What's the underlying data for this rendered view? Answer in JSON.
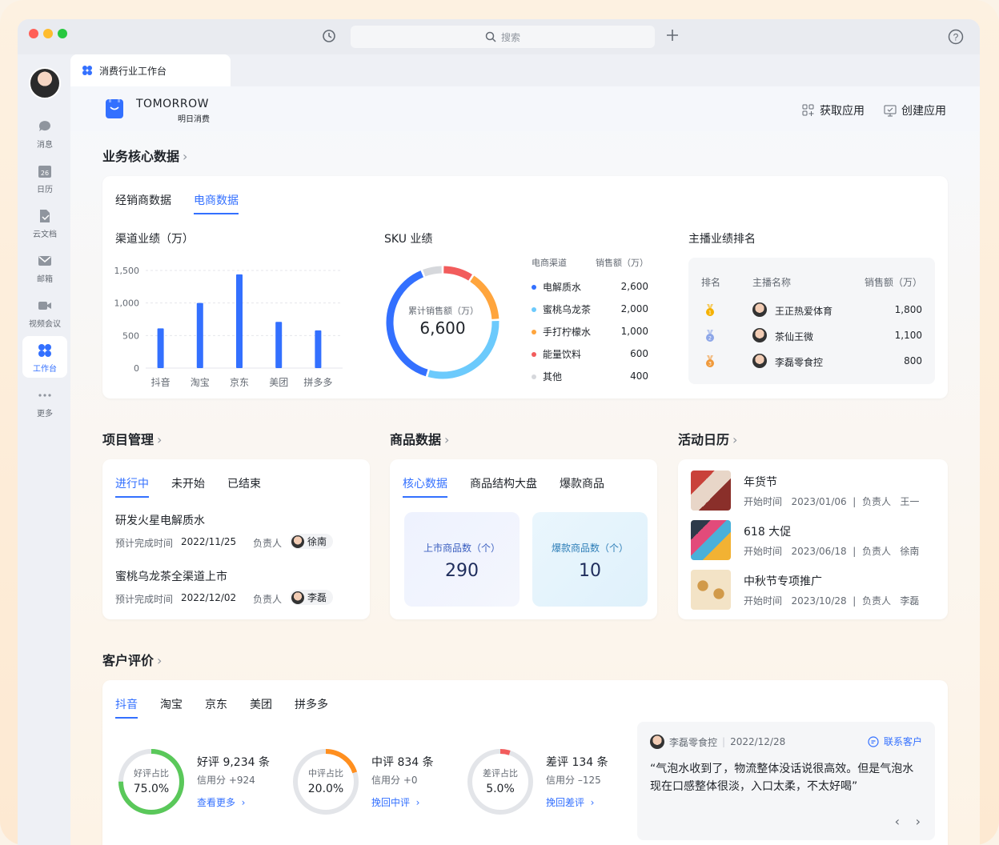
{
  "titlebar": {
    "search_placeholder": "搜索"
  },
  "sidebar": {
    "items": [
      {
        "label": "消息"
      },
      {
        "label": "日历"
      },
      {
        "label": "云文档"
      },
      {
        "label": "邮箱"
      },
      {
        "label": "视频会议"
      },
      {
        "label": "工作台"
      },
      {
        "label": "更多"
      }
    ],
    "calendar_day": "26"
  },
  "tab": {
    "title": "消费行业工作台"
  },
  "header": {
    "brand": "TOMORROW",
    "brand_sub": "明日消费",
    "get_apps": "获取应用",
    "create_app": "创建应用"
  },
  "core": {
    "title": "业务核心数据",
    "tabs": [
      "经销商数据",
      "电商数据"
    ],
    "channel_title": "渠道业绩（万）",
    "sku_title": "SKU 业绩",
    "sku_center_label": "累计销售额（万）",
    "sku_total": "6,600",
    "sku_headers": [
      "电商渠道",
      "销售额（万）"
    ],
    "sku_rows": [
      {
        "name": "电解质水",
        "value": "2,600",
        "color": "#3370ff"
      },
      {
        "name": "蜜桃乌龙茶",
        "value": "2,000",
        "color": "#6ccafc"
      },
      {
        "name": "手打柠檬水",
        "value": "1,000",
        "color": "#ffa53d"
      },
      {
        "name": "能量饮料",
        "value": "600",
        "color": "#f25c5c"
      },
      {
        "name": "其他",
        "value": "400",
        "color": "#d6d8dc"
      }
    ],
    "rank_title": "主播业绩排名",
    "rank_headers": [
      "排名",
      "主播名称",
      "销售额（万）"
    ],
    "rank_rows": [
      {
        "name": "王正热爱体育",
        "value": "1,800",
        "medal": "gold-medal",
        "rank": "1"
      },
      {
        "name": "茶仙王微",
        "value": "1,100",
        "medal": "silver-medal",
        "rank": "2"
      },
      {
        "name": "李磊零食控",
        "value": "800",
        "medal": "bronze-medal",
        "rank": "3"
      }
    ]
  },
  "chart_data": [
    {
      "type": "bar",
      "title": "渠道业绩（万）",
      "categories": [
        "抖音",
        "淘宝",
        "京东",
        "美团",
        "拼多多"
      ],
      "values": [
        610,
        1000,
        1440,
        710,
        580
      ],
      "ylim": [
        0,
        1500
      ],
      "yticks": [
        "0",
        "500",
        "1,000",
        "1,500"
      ],
      "grid": true,
      "color": "#3370ff"
    },
    {
      "type": "pie",
      "title": "SKU 业绩",
      "categories": [
        "电解质水",
        "蜜桃乌龙茶",
        "手打柠檬水",
        "能量饮料",
        "其他"
      ],
      "values": [
        2600,
        2000,
        1000,
        600,
        400
      ]
    }
  ],
  "project": {
    "title": "项目管理",
    "tabs": [
      "进行中",
      "未开始",
      "已结束"
    ],
    "items": [
      {
        "name": "研发火星电解质水",
        "due_label": "预计完成时间",
        "due": "2022/11/25",
        "owner_label": "负责人",
        "owner": "徐南"
      },
      {
        "name": "蜜桃乌龙茶全渠道上市",
        "due_label": "预计完成时间",
        "due": "2022/12/02",
        "owner_label": "负责人",
        "owner": "李磊"
      }
    ]
  },
  "goods": {
    "title": "商品数据",
    "tabs": [
      "核心数据",
      "商品结构大盘",
      "爆款商品"
    ],
    "stats": [
      {
        "label": "上市商品数（个）",
        "value": "290"
      },
      {
        "label": "爆款商品数（个）",
        "value": "10"
      }
    ]
  },
  "events": {
    "title": "活动日历",
    "items": [
      {
        "name": "年货节",
        "start_label": "开始时间",
        "date": "2023/01/06",
        "owner_label": "负责人",
        "owner": "王一"
      },
      {
        "name": "618 大促",
        "start_label": "开始时间",
        "date": "2023/06/18",
        "owner_label": "负责人",
        "owner": "徐南"
      },
      {
        "name": "中秋节专项推广",
        "start_label": "开始时间",
        "date": "2023/10/28",
        "owner_label": "负责人",
        "owner": "李磊"
      }
    ]
  },
  "reviews": {
    "title": "客户评价",
    "tabs": [
      "抖音",
      "淘宝",
      "京东",
      "美团",
      "拼多多"
    ],
    "rings": [
      {
        "label": "好评占比",
        "pct": "75.0%",
        "fraction": 0.75,
        "color": "#5ac85a",
        "head": "好评 9,234 条",
        "score": "信用分 +924",
        "link": "查看更多"
      },
      {
        "label": "中评占比",
        "pct": "20.0%",
        "fraction": 0.2,
        "color": "#ff8f1f",
        "head": "中评 834 条",
        "score": "信用分 +0",
        "link": "挽回中评"
      },
      {
        "label": "差评占比",
        "pct": "5.0%",
        "fraction": 0.05,
        "color": "#f25c5c",
        "head": "差评 134 条",
        "score": "信用分 –125",
        "link": "挽回差评"
      }
    ],
    "comment": {
      "user": "李磊零食控",
      "date": "2022/12/28",
      "contact": "联系客户",
      "text": "“气泡水收到了，物流整体没话说很高效。但是气泡水现在口感整体很淡，入口太柔，不太好喝”"
    }
  },
  "icons": {
    "history": "history-icon",
    "search": "search-icon",
    "plus": "plus-icon",
    "help": "help-icon",
    "chevron": "chevron-right-icon"
  }
}
